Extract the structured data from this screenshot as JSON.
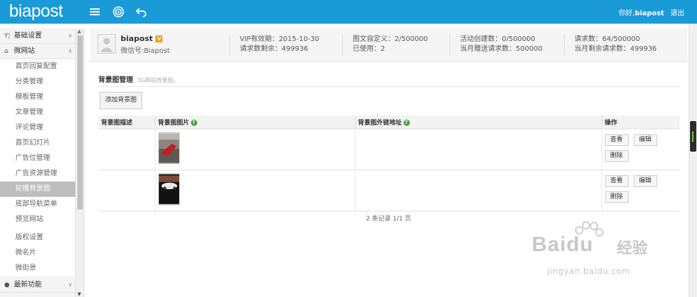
{
  "app": {
    "logo_text": "biapost",
    "accent": "#1a9bd7"
  },
  "topbar": {
    "icons": [
      "menu-icon",
      "target-icon",
      "back-icon"
    ],
    "greeting_prefix": "你好,",
    "username": "biapost",
    "logout_label": "退出"
  },
  "sidebar": {
    "sections": [
      {
        "label": "基础设置",
        "icon": "settings-icon",
        "expanded": false
      },
      {
        "label": "微网站",
        "icon": "home-icon",
        "expanded": true
      }
    ],
    "items": [
      "首页回复配置",
      "分类管理",
      "模板管理",
      "文章管理",
      "评论管理",
      "首页幻灯片",
      "广告位管理",
      "广告资源管理",
      "轮播背景图",
      "底部导航菜单",
      "预览网站",
      "版权设置",
      "微名片",
      "微街景"
    ],
    "active_item": "轮播背景图",
    "bottom_section": {
      "label": "最新功能",
      "icon": "pin-icon"
    }
  },
  "user": {
    "name": "biapost",
    "vip_badge": "V",
    "wechat": "微信号:Biapost",
    "stats": [
      {
        "line1": "VIP有效期：2015-10-30",
        "line2": "请求数剩余：499936"
      },
      {
        "line1": "图文自定义：2/500000",
        "line2": "已使用：2"
      },
      {
        "line1": "活动创建数：0/500000",
        "line2": "当月赠送请求数：500000"
      },
      {
        "line1": "请求数：64/500000",
        "line2": "当月剩余请求数：499936"
      }
    ]
  },
  "section": {
    "title": "背景图管理",
    "subtitle": "3G网站背景图。"
  },
  "add_button": "添加背景图",
  "table": {
    "headers": [
      "背景图描述",
      "背景图图片",
      "背景图外链地址",
      "操作"
    ],
    "rows": [
      {
        "desc": "",
        "image": "red-car-photo",
        "link": ""
      },
      {
        "desc": "",
        "image": "white-car-photo",
        "link": ""
      }
    ],
    "actions": {
      "view": "查看",
      "edit": "编辑",
      "delete": "删除"
    }
  },
  "pager": "2 条记录 1/1 页",
  "watermark": {
    "brand": "Bai",
    "brand_tail": "du",
    "sub": "经验",
    "url": "jingyan.baidu.com"
  }
}
